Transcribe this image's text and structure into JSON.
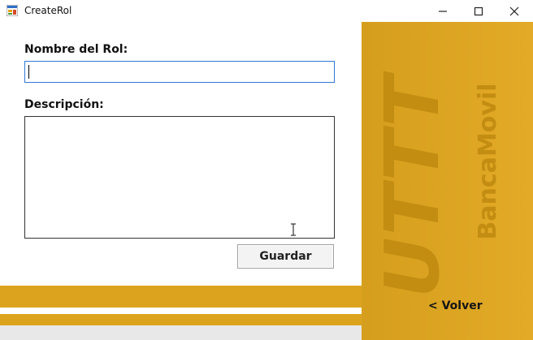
{
  "window": {
    "title": "CreateRol",
    "controls": {
      "minimize": "—",
      "maximize": "☐",
      "close": "✕"
    }
  },
  "form": {
    "name_label": "Nombre del Rol:",
    "name_value": "",
    "description_label": "Descripción:",
    "description_value": "",
    "save_label": "Guardar"
  },
  "sidebar": {
    "brand_main": "UTTT",
    "brand_sub": "BancaMovil",
    "back_link": "< Volver"
  },
  "colors": {
    "accent": "#dca41e",
    "accent_dark": "#c38d12",
    "focus_border": "#2f78d6"
  },
  "icons": {
    "app": "form-app-icon",
    "cursor": "i-beam-cursor"
  }
}
